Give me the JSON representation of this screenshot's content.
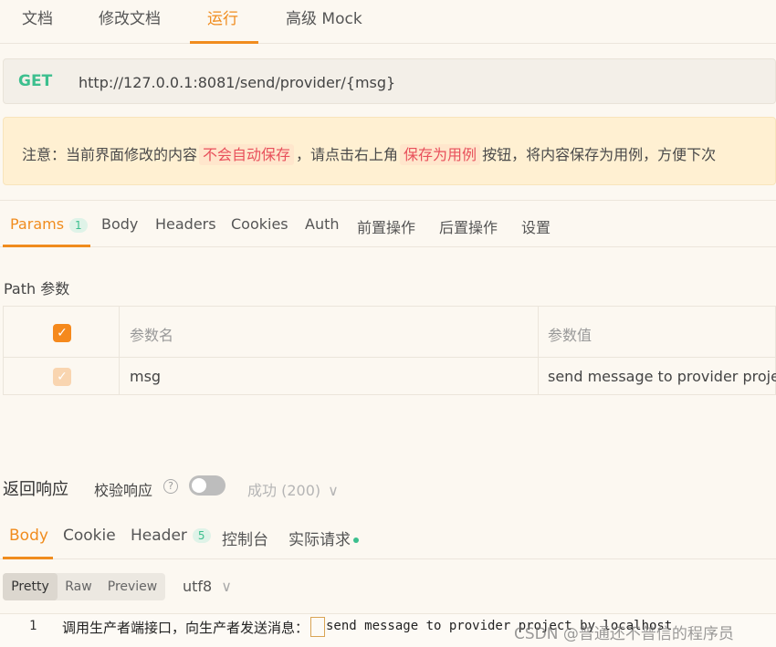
{
  "top_tabs": [
    {
      "label": "文档"
    },
    {
      "label": "修改文档"
    },
    {
      "label": "运行",
      "active": true
    },
    {
      "label": "高级 Mock"
    }
  ],
  "request": {
    "method": "GET",
    "url": "http://127.0.0.1:8081/send/provider/{msg}"
  },
  "notice": {
    "prefix": "注意：当前界面修改的内容",
    "highlight1": "不会自动保存",
    "middle": "，请点击右上角",
    "highlight2": "保存为用例",
    "suffix": "按钮，将内容保存为用例，方便下次"
  },
  "param_tabs": [
    {
      "label": "Params",
      "badge": "1",
      "active": true
    },
    {
      "label": "Body"
    },
    {
      "label": "Headers"
    },
    {
      "label": "Cookies"
    },
    {
      "label": "Auth"
    },
    {
      "label": "前置操作"
    },
    {
      "label": "后置操作"
    },
    {
      "label": "设置"
    }
  ],
  "path_params": {
    "title": "Path 参数",
    "columns": [
      "参数名",
      "参数值"
    ],
    "rows": [
      {
        "checked": true,
        "name": "msg",
        "value": "send message to provider projec"
      }
    ]
  },
  "response": {
    "title": "返回响应",
    "validate_label": "校验响应",
    "help_icon": "?",
    "validate_enabled": false,
    "status_select": "成功 (200)",
    "status_chevron": "∨"
  },
  "body_tabs": [
    {
      "label": "Body",
      "active": true
    },
    {
      "label": "Cookie"
    },
    {
      "label": "Header",
      "badge": "5"
    },
    {
      "label": "控制台"
    },
    {
      "label": "实际请求",
      "dot": true
    }
  ],
  "format": {
    "options": [
      "Pretty",
      "Raw",
      "Preview"
    ],
    "selected": "Pretty",
    "encoding": "utf8",
    "encoding_chevron": "∨"
  },
  "code": {
    "line_number": "1",
    "text_cn": "调用生产者端接口，向生产者发送消息：",
    "text_en": "send message to provider project by localhost"
  },
  "watermark": "CSDN @普通还不普信的程序员",
  "check_glyph": "✓"
}
